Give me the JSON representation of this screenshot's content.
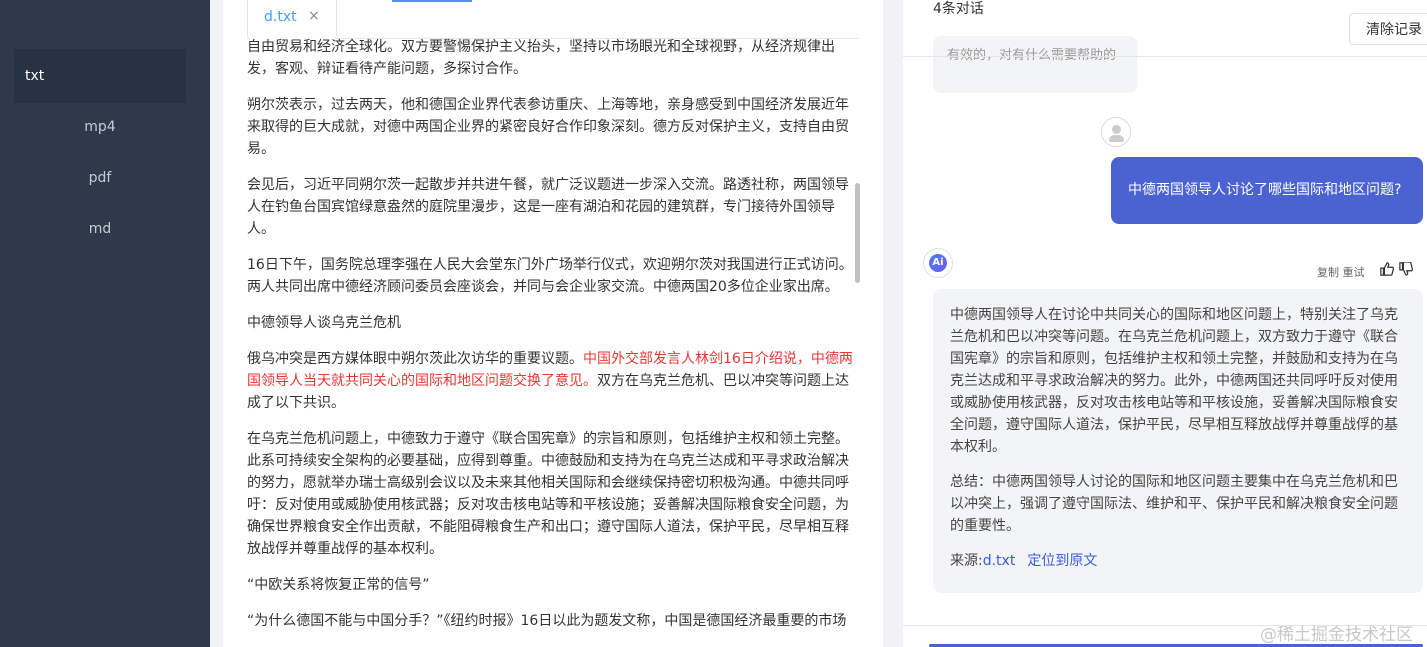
{
  "sidebar": {
    "items": [
      {
        "label": "txt",
        "active": true
      },
      {
        "label": "mp4"
      },
      {
        "label": "pdf"
      },
      {
        "label": "md"
      }
    ]
  },
  "document": {
    "tab": {
      "label": "d.txt",
      "close_icon": "×"
    },
    "paragraphs": [
      "自由贸易和经济全球化。双方要警惕保护主义抬头，坚持以市场眼光和全球视野，从经济规律出发，客观、辩证看待产能问题，多探讨合作。",
      "朔尔茨表示，过去两天，他和德国企业界代表参访重庆、上海等地，亲身感受到中国经济发展近年来取得的巨大成就，对德中两国企业界的紧密良好合作印象深刻。德方反对保护主义，支持自由贸易。",
      "会见后，习近平同朔尔茨一起散步并共进午餐，就广泛议题进一步深入交流。路透社称，两国领导人在钓鱼台国宾馆绿意盎然的庭院里漫步，这是一座有湖泊和花园的建筑群，专门接待外国领导人。",
      "16日下午，国务院总理李强在人民大会堂东门外广场举行仪式，欢迎朔尔茨对我国进行正式访问。两人共同出席中德经济顾问委员会座谈会，并同与会企业家交流。中德两国20多位企业家出席。",
      "中德领导人谈乌克兰危机"
    ],
    "mixed_paragraph": {
      "before": "俄乌冲突是西方媒体眼中朔尔茨此次访华的重要议题。",
      "highlight": "中国外交部发言人林剑16日介绍说，中德两国领导人当天就共同关心的国际和地区问题交换了意见。",
      "after": "双方在乌克兰危机、巴以冲突等问题上达成了以下共识。"
    },
    "paragraphs_after": [
      "在乌克兰危机问题上，中德致力于遵守《联合国宪章》的宗旨和原则，包括维护主权和领土完整。此系可持续安全架构的必要基础，应得到尊重。中德鼓励和支持为在乌克兰达成和平寻求政治解决的努力，愿就举办瑞士高级别会议以及未来其他相关国际和会继续保持密切积极沟通。中德共同呼吁：反对使用或威胁使用核武器；反对攻击核电站等和平核设施；妥善解决国际粮食安全问题，为确保世界粮食安全作出贡献，不能阻碍粮食生产和出口；遵守国际人道法，保护平民，尽早相互释放战俘并尊重战俘的基本权利。",
      "“中欧关系将恢复正常的信号”",
      "“为什么德国不能与中国分手？”《纽约时报》16日以此为题发文称，中国是德国经济最重要的市场"
    ]
  },
  "chat": {
    "count_label": "4条对话",
    "clear_button": "清除记录",
    "previous_bubble_text": "有效的，对有什么需要帮助的",
    "user_question": "中德两国领导人讨论了哪些国际和地区问题?",
    "ai_avatar_text": "Ai",
    "actions_label": "复制 重试",
    "answer_paragraphs": [
      "中德两国领导人在讨论中共同关心的国际和地区问题上，特别关注了乌克兰危机和巴以冲突等问题。在乌克兰危机问题上，双方致力于遵守《联合国宪章》的宗旨和原则，包括维护主权和领土完整，并鼓励和支持为在乌克兰达成和平寻求政治解决的努力。此外，中德两国还共同呼吁反对使用或威胁使用核武器，反对攻击核电站等和平核设施，妥善解决国际粮食安全问题，遵守国际人道法，保护平民，尽早相互释放战俘并尊重战俘的基本权利。",
      "总结：中德两国领导人讨论的国际和地区问题主要集中在乌克兰危机和巴以冲突上，强调了遵守国际法、维护和平、保护平民和解决粮食安全问题的重要性。"
    ],
    "source_label": "来源:",
    "source_file": "d.txt",
    "locate_link": "定位到原文"
  },
  "watermark": "@稀土掘金技术社区",
  "colors": {
    "sidebar_bg": "#2e3a4b",
    "accent": "#4b63d0",
    "highlight_red": "#e53935",
    "link": "#3b5bdb"
  },
  "icons": {
    "close": "close-icon",
    "thumb_up": "thumb-up-icon",
    "thumb_down": "thumb-down-icon",
    "user_avatar": "user-avatar-icon",
    "ai_avatar": "ai-avatar-icon"
  }
}
